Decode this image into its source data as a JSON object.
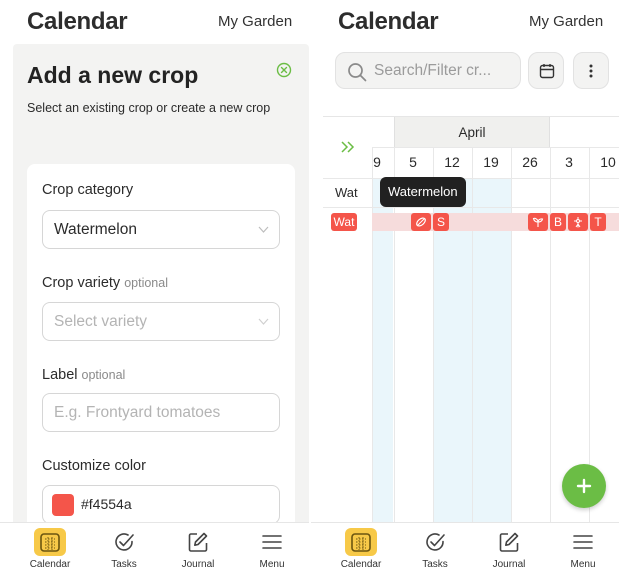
{
  "left": {
    "header": {
      "title": "Calendar",
      "garden": "My Garden"
    },
    "sheet": {
      "title": "Add a new crop",
      "subtitle": "Select an existing crop or create a new crop",
      "close_icon": "close-circle-icon",
      "fields": {
        "category": {
          "label": "Crop category",
          "value": "Watermelon"
        },
        "variety": {
          "label": "Crop variety",
          "optional": "optional",
          "placeholder": "Select variety"
        },
        "label": {
          "label": "Label",
          "optional": "optional",
          "placeholder": "E.g. Frontyard tomatoes"
        },
        "color": {
          "label": "Customize color",
          "value": "#f4554a"
        }
      }
    }
  },
  "right": {
    "header": {
      "title": "Calendar",
      "garden": "My Garden"
    },
    "search": {
      "placeholder": "Search/Filter cr...",
      "icon": "search-icon"
    },
    "calendar_button_icon": "calendar-icon",
    "more_button_icon": "more-vertical-icon",
    "timeline": {
      "expand_icon": "double-chevron-right-icon",
      "month": "April",
      "days": [
        "9",
        "5",
        "12",
        "19",
        "26",
        "3",
        "10"
      ],
      "crop_name_short": "Wat",
      "crop_tag": "Wat",
      "chips": [
        {
          "icon": "seed-icon",
          "text": ""
        },
        {
          "icon": "",
          "text": "S"
        },
        {
          "icon": "sprout-icon",
          "text": ""
        },
        {
          "icon": "",
          "text": "B"
        },
        {
          "icon": "flower-icon",
          "text": ""
        },
        {
          "icon": "",
          "text": "T"
        }
      ],
      "tooltip": "Watermelon",
      "accent": "#f4554a"
    },
    "fab_icon": "plus-icon"
  },
  "nav": [
    {
      "label": "Calendar",
      "icon": "calendar-grid-icon",
      "active": true
    },
    {
      "label": "Tasks",
      "icon": "check-circle-icon",
      "active": false
    },
    {
      "label": "Journal",
      "icon": "edit-icon",
      "active": false
    },
    {
      "label": "Menu",
      "icon": "menu-icon",
      "active": false
    }
  ]
}
